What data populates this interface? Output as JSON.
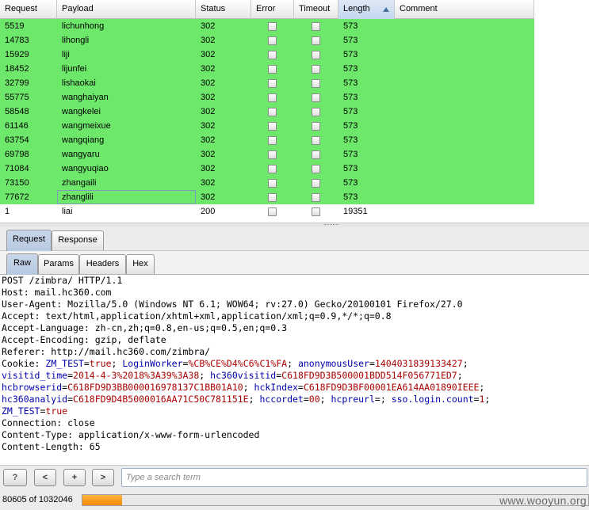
{
  "results": {
    "columns": [
      "Request",
      "Payload",
      "Status",
      "Error",
      "Timeout",
      "Length",
      "Comment"
    ],
    "sorted_column": "Length",
    "highlight_color": "#6ee86b",
    "rows": [
      {
        "request": "5519",
        "payload": "lichunhong",
        "status": "302",
        "length": "573",
        "highlight": true
      },
      {
        "request": "14783",
        "payload": "lihongli",
        "status": "302",
        "length": "573",
        "highlight": true
      },
      {
        "request": "15929",
        "payload": "liji",
        "status": "302",
        "length": "573",
        "highlight": true
      },
      {
        "request": "18452",
        "payload": "lijunfei",
        "status": "302",
        "length": "573",
        "highlight": true
      },
      {
        "request": "32799",
        "payload": "lishaokai",
        "status": "302",
        "length": "573",
        "highlight": true
      },
      {
        "request": "55775",
        "payload": "wanghaiyan",
        "status": "302",
        "length": "573",
        "highlight": true
      },
      {
        "request": "58548",
        "payload": "wangkelei",
        "status": "302",
        "length": "573",
        "highlight": true
      },
      {
        "request": "61146",
        "payload": "wangmeixue",
        "status": "302",
        "length": "573",
        "highlight": true
      },
      {
        "request": "63754",
        "payload": "wangqiang",
        "status": "302",
        "length": "573",
        "highlight": true
      },
      {
        "request": "69798",
        "payload": "wangyaru",
        "status": "302",
        "length": "573",
        "highlight": true
      },
      {
        "request": "71084",
        "payload": "wangyuqiao",
        "status": "302",
        "length": "573",
        "highlight": true
      },
      {
        "request": "73150",
        "payload": "zhangaili",
        "status": "302",
        "length": "573",
        "highlight": true
      },
      {
        "request": "77672",
        "payload": "zhanglili",
        "status": "302",
        "length": "573",
        "highlight": true,
        "selected_cell": "payload"
      },
      {
        "request": "1",
        "payload": "liai",
        "status": "200",
        "length": "19351",
        "highlight": false
      }
    ]
  },
  "outer_tabs": {
    "request": "Request",
    "response": "Response",
    "active": "Request"
  },
  "inner_tabs": {
    "raw": "Raw",
    "params": "Params",
    "headers": "Headers",
    "hex": "Hex",
    "active": "Raw"
  },
  "request_lines": {
    "l1": "POST /zimbra/ HTTP/1.1",
    "l2": "Host: mail.hc360.com",
    "l3": "User-Agent: Mozilla/5.0 (Windows NT 6.1; WOW64; rv:27.0) Gecko/20100101 Firefox/27.0",
    "l4": "Accept: text/html,application/xhtml+xml,application/xml;q=0.9,*/*;q=0.8",
    "l5": "Accept-Language: zh-cn,zh;q=0.8,en-us;q=0.5,en;q=0.3",
    "l6": "Accept-Encoding: gzip, deflate",
    "l7": "Referer: http://mail.hc360.com/zimbra/",
    "cookie_prefix": "Cookie: ",
    "c1k": "ZM_TEST",
    "c1v": "true",
    "c2k": "LoginWorker",
    "c2v": "%CB%CE%D4%C6%C1%FA",
    "c3k": "anonymousUser",
    "c3v": "1404031839133427",
    "c4k": "visitid_time",
    "c4v": "2014-4-3%2018%3A39%3A38",
    "c5k": "hc360visitid",
    "c5v": "C618FD9D3B500001BDD514F056771ED7",
    "c6k": "hcbrowserid",
    "c6v": "C618FD9D3BB000016978137C1BB01A10",
    "c7k": "hckIndex",
    "c7v": "C618FD9D3BF00001EA614AA01890IEEE",
    "c8k": "hc360analyid",
    "c8v": "C618FD9D4B5000016AA71C50C781151E",
    "c9k": "hccordet",
    "c9v": "00",
    "c10k": "hcpreurl",
    "c10v": "",
    "c11k": "sso.login.count",
    "c11v": "1",
    "c12k": "ZM_TEST",
    "c12v": "true",
    "l9": "Connection: close",
    "l10": "Content-Type: application/x-www-form-urlencoded",
    "l11": "Content-Length: 65"
  },
  "search": {
    "help_label": "?",
    "prev_label": "<",
    "plus_label": "+",
    "next_label": ">",
    "placeholder": "Type a search term"
  },
  "status": {
    "progress_text": "80605 of 1032046",
    "progress_fraction": 0.078,
    "progress_color": "#f28a00",
    "watermark": "www.wooyun.org"
  }
}
